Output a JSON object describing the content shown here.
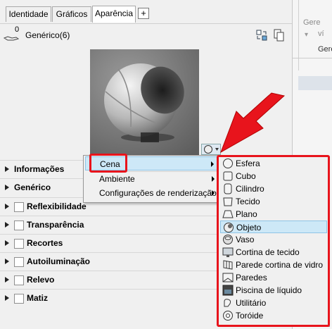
{
  "tabs": [
    {
      "label": "Identidade"
    },
    {
      "label": "Gráficos"
    },
    {
      "label": "Aparência"
    }
  ],
  "add_tab_label": "+",
  "header": {
    "count": "0",
    "title": "Genérico(6)"
  },
  "properties": [
    {
      "label": "Informações",
      "has_checkbox": false
    },
    {
      "label": "Genérico",
      "has_checkbox": false
    },
    {
      "label": "Reflexibilidade",
      "has_checkbox": true
    },
    {
      "label": "Transparência",
      "has_checkbox": true
    },
    {
      "label": "Recortes",
      "has_checkbox": true
    },
    {
      "label": "Autoiluminação",
      "has_checkbox": true
    },
    {
      "label": "Relevo",
      "has_checkbox": true
    },
    {
      "label": "Matiz",
      "has_checkbox": true
    }
  ],
  "context_menu": {
    "items": [
      {
        "label": "Cena",
        "submenu": true,
        "highlighted": true
      },
      {
        "label": "Ambiente",
        "submenu": true,
        "highlighted": false
      },
      {
        "label": "Configurações de renderização",
        "submenu": true,
        "highlighted": false
      }
    ]
  },
  "submenu": {
    "items": [
      {
        "label": "Esfera",
        "icon": "sphere-icon"
      },
      {
        "label": "Cubo",
        "icon": "cube-icon"
      },
      {
        "label": "Cilindro",
        "icon": "cylinder-icon"
      },
      {
        "label": "Tecido",
        "icon": "cloth-icon"
      },
      {
        "label": "Plano",
        "icon": "plane-icon"
      },
      {
        "label": "Objeto",
        "icon": "object-icon",
        "highlighted": true
      },
      {
        "label": "Vaso",
        "icon": "vase-icon"
      },
      {
        "label": "Cortina de tecido",
        "icon": "drapery-icon"
      },
      {
        "label": "Parede cortina de vidro",
        "icon": "glass-curtain-wall-icon"
      },
      {
        "label": "Paredes",
        "icon": "walls-icon"
      },
      {
        "label": "Piscina de líquido",
        "icon": "pool-icon"
      },
      {
        "label": "Utilitário",
        "icon": "utility-icon"
      },
      {
        "label": "Toróide",
        "icon": "torus-icon"
      }
    ]
  },
  "right_pane": {
    "line1": "Gere",
    "line2": "ví",
    "line3": "Gere"
  },
  "colors": {
    "highlight": "#cde8f7",
    "annotation_red": "#e8141c"
  }
}
